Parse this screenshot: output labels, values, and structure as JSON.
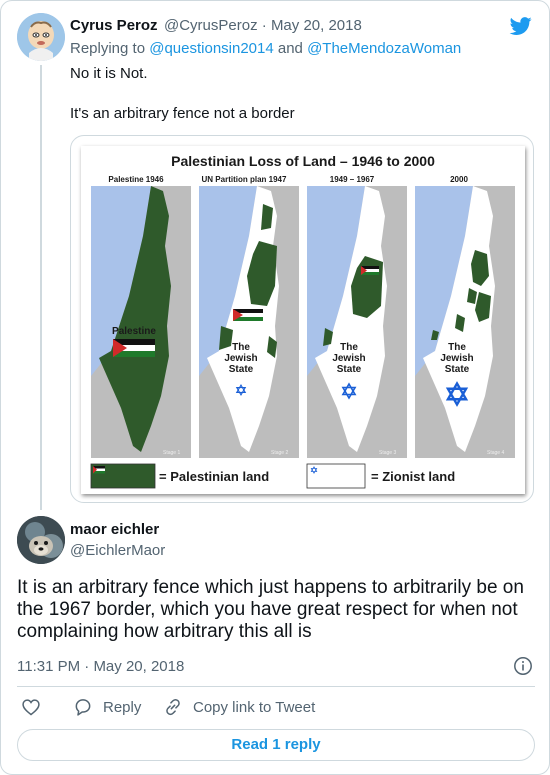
{
  "tweet1": {
    "display_name": "Cyrus Peroz",
    "handle": "@CyrusPeroz",
    "separator": "·",
    "date": "May 20, 2018",
    "replying_prefix": "Replying to",
    "reply_to_1": "@questionsin2014",
    "reply_and": "and",
    "reply_to_2": "@TheMendozaWoman",
    "text_line1": "No it is Not.",
    "text_line2": "It's an arbitrary fence not a border"
  },
  "map_image": {
    "title": "Palestinian Loss of Land – 1946 to 2000",
    "panel_labels": [
      "Palestine 1946",
      "UN Partition plan 1947",
      "1949 – 1967",
      "2000"
    ],
    "palestine_label": "Palestine",
    "jewish_state_line1": "The",
    "jewish_state_line2": "Jewish",
    "jewish_state_line3": "State",
    "legend_palestinian": "= Palestinian land",
    "legend_zionist": "= Zionist land",
    "stage_labels": [
      "Stage 1",
      "Stage 2",
      "Stage 3",
      "Stage 4"
    ]
  },
  "tweet2": {
    "display_name": "maor eichler",
    "handle": "@EichlerMaor",
    "text": "It is an arbitrary fence which just happens to arbitrarily be on the 1967 border, which you have great respect for when not complaining how arbitrary this all is",
    "time": "11:31 PM",
    "separator": "·",
    "date": "May 20, 2018"
  },
  "actions": {
    "reply_label": "Reply",
    "copy_link_label": "Copy link to Tweet",
    "read_replies_label": "Read 1 reply"
  },
  "colors": {
    "accent": "#1b95e0",
    "twitter_logo": "#1d9bf0",
    "muted_text": "#536471",
    "land_green": "#2f5a2b",
    "sea_blue": "#a9c2ea"
  },
  "icons": [
    "twitter-logo-icon",
    "info-icon",
    "heart-icon",
    "reply-icon",
    "link-icon",
    "star-of-david-icon",
    "palestinian-flag-icon"
  ]
}
